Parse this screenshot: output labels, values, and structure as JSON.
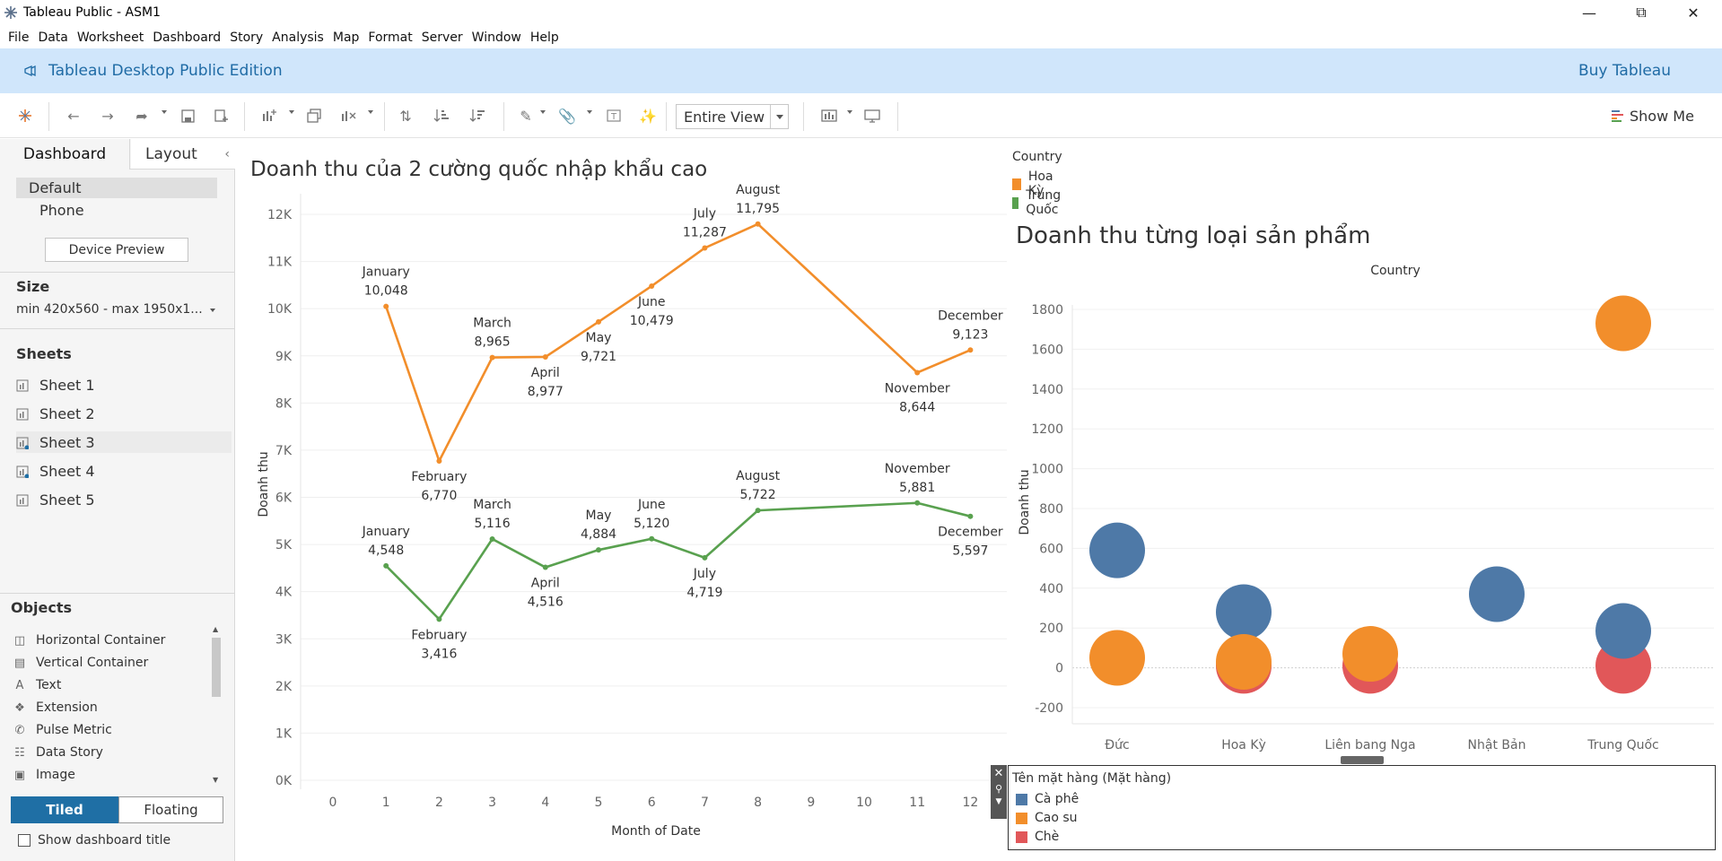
{
  "window": {
    "title": "Tableau Public - ASM1"
  },
  "menu": [
    "File",
    "Data",
    "Worksheet",
    "Dashboard",
    "Story",
    "Analysis",
    "Map",
    "Format",
    "Server",
    "Window",
    "Help"
  ],
  "banner": {
    "edition": "Tableau Desktop Public Edition",
    "buy": "Buy Tableau"
  },
  "toolbar": {
    "fit": "Entire View",
    "show_me": "Show Me"
  },
  "left_pane": {
    "tabs": {
      "dashboard": "Dashboard",
      "layout": "Layout"
    },
    "devices": {
      "default": "Default",
      "phone": "Phone",
      "preview": "Device Preview"
    },
    "size": {
      "heading": "Size",
      "value": "min 420x560 - max 1950x1..."
    },
    "sheets": {
      "heading": "Sheets",
      "items": [
        "Sheet 1",
        "Sheet 2",
        "Sheet 3",
        "Sheet 4",
        "Sheet 5"
      ]
    },
    "objects": {
      "heading": "Objects",
      "items": [
        "Horizontal Container",
        "Vertical Container",
        "Text",
        "Extension",
        "Pulse Metric",
        "Data Story",
        "Image"
      ]
    },
    "layout_mode": {
      "tiled": "Tiled",
      "floating": "Floating"
    },
    "show_title": "Show dashboard title"
  },
  "colors": {
    "orange": "#f28e2b",
    "green": "#59a14f",
    "blue": "#4e79a7",
    "red": "#e15759",
    "accent": "#1f6fa5"
  },
  "legend_country": {
    "title": "Country",
    "items": [
      {
        "label": "Hoa Kỳ",
        "color": "#f28e2b"
      },
      {
        "label": "Trung Quốc",
        "color": "#59a14f"
      }
    ]
  },
  "legend_product": {
    "title": "Tên mặt hàng (Mặt hàng)",
    "items": [
      {
        "label": "Cà phê",
        "color": "#4e79a7"
      },
      {
        "label": "Cao su",
        "color": "#f28e2b"
      },
      {
        "label": "Chè",
        "color": "#e15759"
      }
    ]
  },
  "chart_data": [
    {
      "type": "line",
      "title": "Doanh thu của 2 cường quốc nhập khẩu cao",
      "xlabel": "Month of Date",
      "ylabel": "Doanh thu",
      "xlim": [
        0,
        13
      ],
      "ylim": [
        0,
        12000
      ],
      "xticks": [
        "0",
        "1",
        "2",
        "3",
        "4",
        "5",
        "6",
        "7",
        "8",
        "9",
        "10",
        "11",
        "12"
      ],
      "yticks": [
        "0K",
        "1K",
        "2K",
        "3K",
        "4K",
        "5K",
        "6K",
        "7K",
        "8K",
        "9K",
        "10K",
        "11K",
        "12K"
      ],
      "grid": true,
      "series": [
        {
          "name": "Hoa Kỳ",
          "color": "#f28e2b",
          "x": [
            1,
            2,
            3,
            4,
            5,
            6,
            7,
            8,
            11,
            12
          ],
          "y": [
            10048,
            6770,
            8965,
            8977,
            9721,
            10479,
            11287,
            11795,
            8644,
            9123
          ],
          "labels": [
            "January",
            "February",
            "March",
            "April",
            "May",
            "June",
            "July",
            "August",
            "November",
            "December"
          ],
          "value_labels": [
            "10,048",
            "6,770",
            "8,965",
            "8,977",
            "9,721",
            "10,479",
            "11,287",
            "11,795",
            "8,644",
            "9,123"
          ]
        },
        {
          "name": "Trung Quốc",
          "color": "#59a14f",
          "x": [
            1,
            2,
            3,
            4,
            5,
            6,
            7,
            8,
            11,
            12
          ],
          "y": [
            4548,
            3416,
            5116,
            4516,
            4884,
            5120,
            4719,
            5722,
            5881,
            5597
          ],
          "labels": [
            "January",
            "February",
            "March",
            "April",
            "May",
            "June",
            "July",
            "August",
            "November",
            "December"
          ],
          "value_labels": [
            "4,548",
            "3,416",
            "5,116",
            "4,516",
            "4,884",
            "5,120",
            "4,719",
            "5,722",
            "5,881",
            "5,597"
          ]
        }
      ]
    },
    {
      "type": "scatter",
      "title": "Doanh thu từng loại sản phẩm",
      "xlabel": "Country",
      "ylabel": "Doanh thu",
      "ylim": [
        -200,
        1800
      ],
      "yticks": [
        "-200",
        "0",
        "200",
        "400",
        "600",
        "800",
        "1000",
        "1200",
        "1400",
        "1600",
        "1800"
      ],
      "categories": [
        "Đức",
        "Hoa Kỳ",
        "Liên bang Nga",
        "Nhật Bản",
        "Trung Quốc"
      ],
      "series": [
        {
          "name": "Chè",
          "color": "#e15759",
          "values": [
            null,
            10,
            10,
            null,
            10
          ]
        },
        {
          "name": "Cà phê",
          "color": "#4e79a7",
          "values": [
            590,
            280,
            null,
            370,
            185
          ]
        },
        {
          "name": "Cao su",
          "color": "#f28e2b",
          "values": [
            50,
            30,
            70,
            null,
            1730
          ]
        }
      ]
    }
  ]
}
